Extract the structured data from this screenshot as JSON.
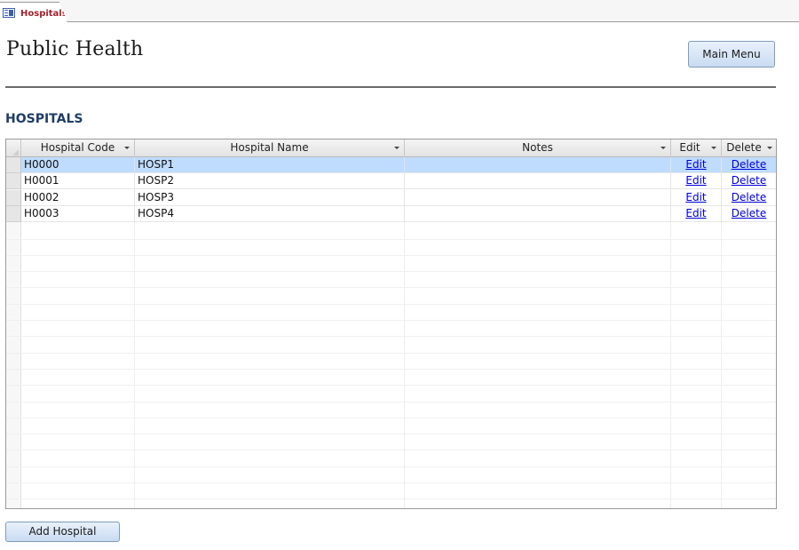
{
  "tab": {
    "label": "Hospitals",
    "icon": "form-icon"
  },
  "header": {
    "app_title": "Public Health",
    "main_menu_label": "Main Menu"
  },
  "section": {
    "title": "HOSPITALS"
  },
  "table": {
    "columns": [
      {
        "key": "code",
        "label": "Hospital Code"
      },
      {
        "key": "name",
        "label": "Hospital Name"
      },
      {
        "key": "notes",
        "label": "Notes"
      },
      {
        "key": "edit",
        "label": "Edit"
      },
      {
        "key": "delete",
        "label": "Delete"
      }
    ],
    "rows": [
      {
        "code": "H0000",
        "name": "HOSP1",
        "notes": "",
        "edit": "Edit",
        "delete": "Delete",
        "selected": true
      },
      {
        "code": "H0001",
        "name": "HOSP2",
        "notes": "",
        "edit": "Edit",
        "delete": "Delete",
        "selected": false
      },
      {
        "code": "H0002",
        "name": "HOSP3",
        "notes": "",
        "edit": "Edit",
        "delete": "Delete",
        "selected": false
      },
      {
        "code": "H0003",
        "name": "HOSP4",
        "notes": "",
        "edit": "Edit",
        "delete": "Delete",
        "selected": false
      }
    ]
  },
  "footer": {
    "add_label": "Add Hospital"
  },
  "colors": {
    "accent_title": "#1f3d66",
    "tab_label": "#a5202a",
    "link": "#0000d8",
    "selection": "#bfdcff"
  }
}
